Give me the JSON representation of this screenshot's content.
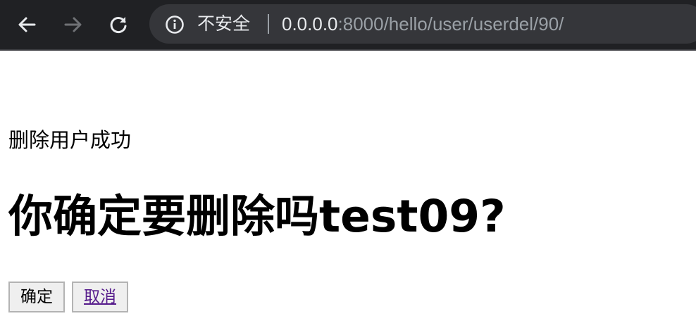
{
  "browser": {
    "security_label": "不安全",
    "url_host": "0.0.0.0",
    "url_rest": ":8000/hello/user/userdel/90/"
  },
  "page": {
    "status_message": "删除用户成功",
    "heading": "你确定要删除吗test09?",
    "confirm_label": "确定",
    "cancel_label": "取消"
  }
}
